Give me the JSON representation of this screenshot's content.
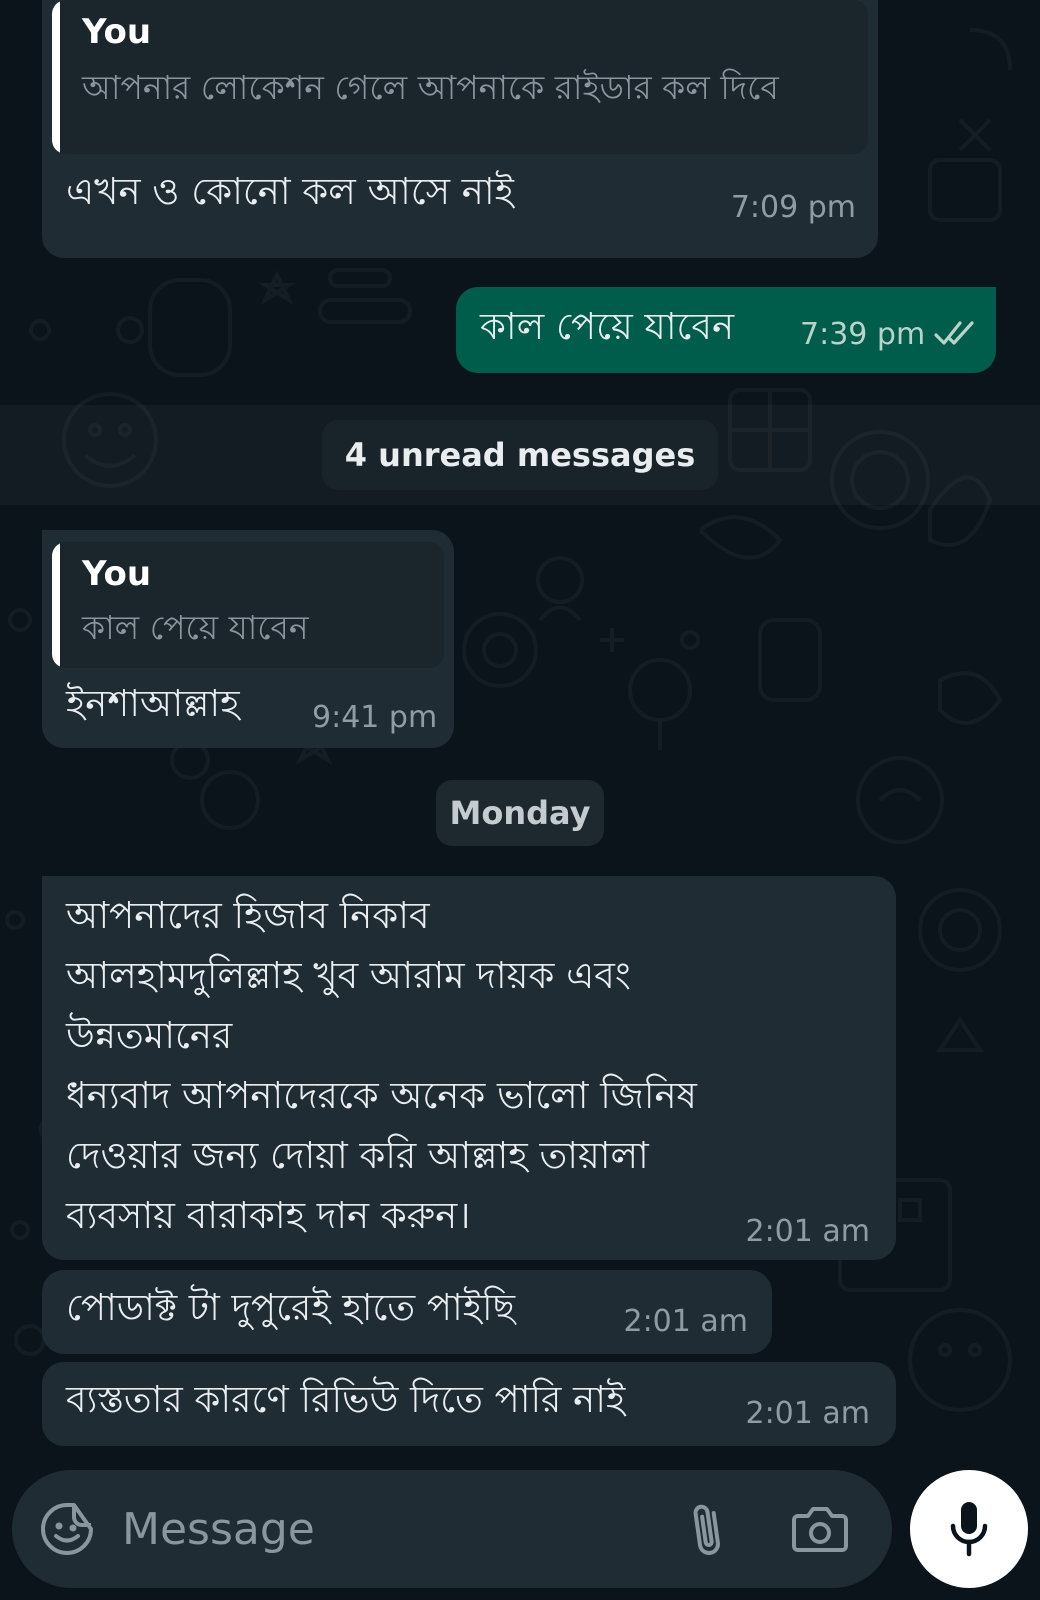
{
  "messages": [
    {
      "quote_author": "You",
      "quote_text": "আপনার লোকেশন গেলে আপনাকে রাইডার কল দিবে",
      "text": "এখন ও কোনো কল আসে নাই",
      "time": "7:09 pm"
    },
    {
      "text": "কাল পেয়ে যাবেন",
      "time": "7:39 pm",
      "status_icon": "double-check-icon"
    },
    {
      "quote_author": "You",
      "quote_text": "কাল পেয়ে যাবেন",
      "text": "ইনশাআল্লাহ",
      "time": "9:41 pm"
    },
    {
      "lines": [
        "আপনাদের হিজাব নিকাব",
        "আলহামদুলিল্লাহ খুব আরাম দায়ক এবং",
        "উন্নতমানের",
        "ধন্যবাদ আপনাদেরকে অনেক ভালো জিনিষ",
        "দেওয়ার জন্য দোয়া করি আল্লাহ তায়ালা",
        "ব্যবসায় বারাকাহ দান করুন।"
      ],
      "time": "2:01 am"
    },
    {
      "text": "পোডাক্ট টা দুপুরেই হাতে পাইছি",
      "time": "2:01 am"
    },
    {
      "text": "ব্যস্ততার কারণে রিভিউ দিতে পারি নাই",
      "time": "2:01 am"
    }
  ],
  "unread_label": "4 unread messages",
  "date_label": "Monday",
  "composer": {
    "placeholder": "Message",
    "emoji_icon": "emoji-sticker-icon",
    "attach_icon": "paperclip-icon",
    "camera_icon": "camera-icon",
    "mic_icon": "microphone-icon"
  },
  "colors": {
    "background": "#0b141a",
    "incoming_bubble": "#1f2c34",
    "outgoing_bubble": "#005c4b",
    "text": "#e9edef",
    "meta": "#8f9ca3"
  }
}
